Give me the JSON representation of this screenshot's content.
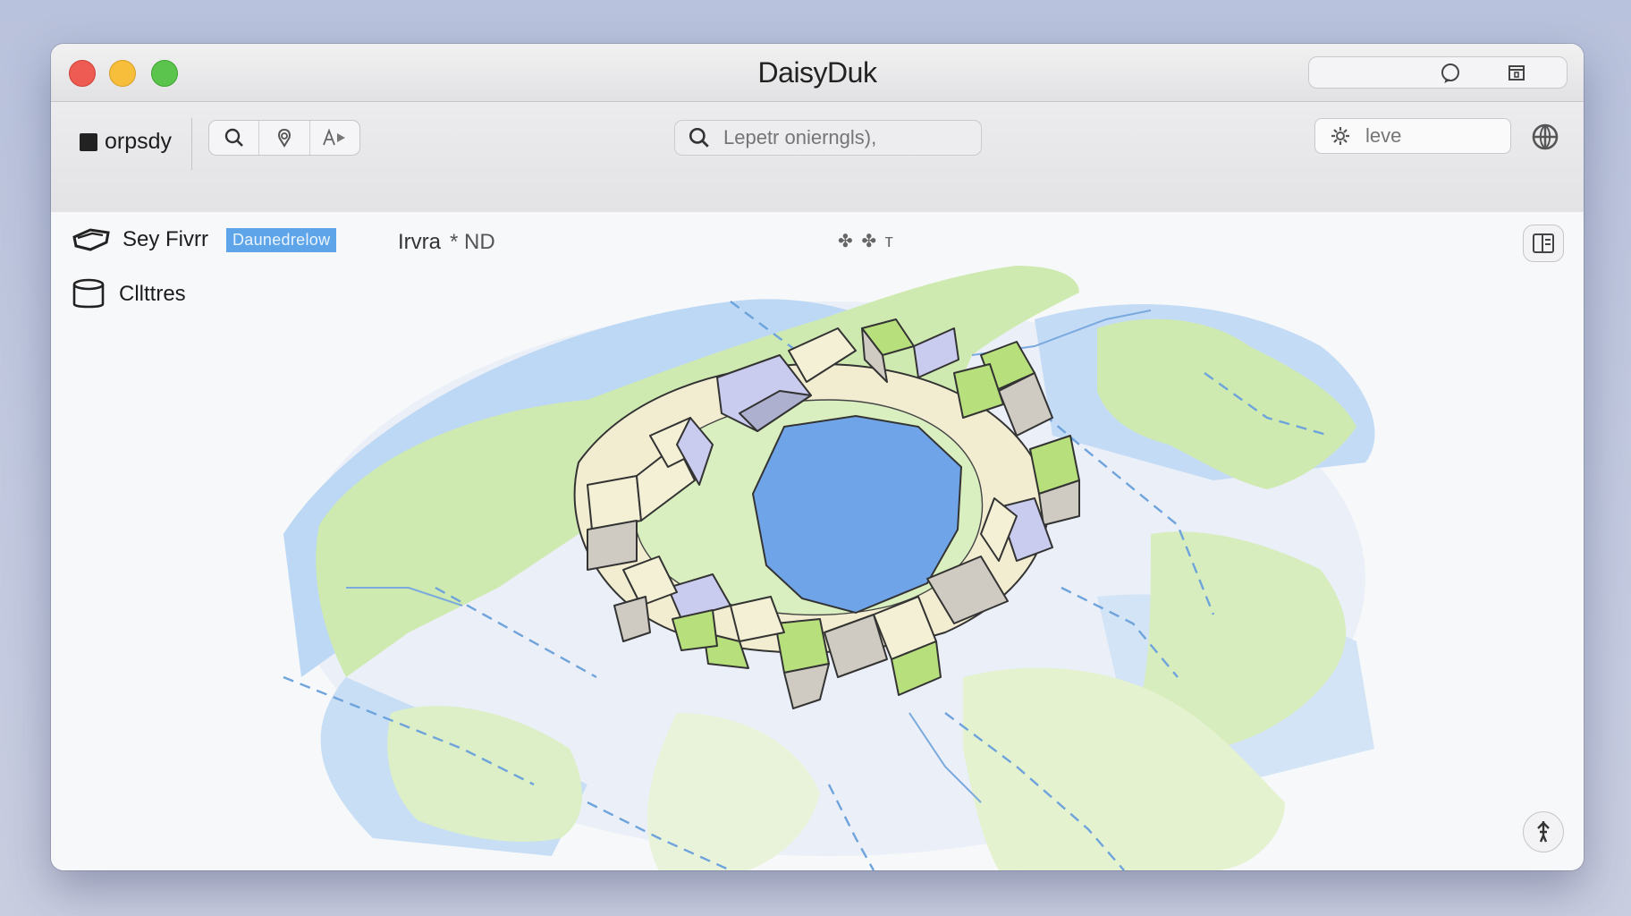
{
  "window": {
    "title": "DaisyDuk"
  },
  "toolbar": {
    "left_label": "orpsdy",
    "search_placeholder": "Lepetr onierngls),",
    "field_placeholder": "leve"
  },
  "content": {
    "layer_label": "Sey Fivrr",
    "badge": "Daunedrelow",
    "meta_text": "Irvra",
    "meta_extra": "* ND",
    "meta_icons": "✤ ✤ т",
    "second_label": "Cllttres"
  },
  "colors": {
    "accent_badge": "#5ea4e8",
    "land_green": "#cfeab0",
    "water_blue": "#bcd8f4",
    "lake_blue": "#6fa5e8",
    "block_cream": "#f4f0d5",
    "block_green": "#b7e07c",
    "block_gray": "#cfcbc2",
    "block_lavender": "#c9cbef"
  },
  "icons": {
    "toolbar_square": "square-icon",
    "search": "search-icon",
    "compass": "compass-icon",
    "text_play": "text-play-icon",
    "chat": "chat-icon",
    "calendar": "calendar-icon",
    "settings": "gear-icon",
    "globe": "globe-icon",
    "layers": "layers-icon",
    "database": "database-icon",
    "panel": "panel-icon",
    "pin": "pin-icon"
  }
}
